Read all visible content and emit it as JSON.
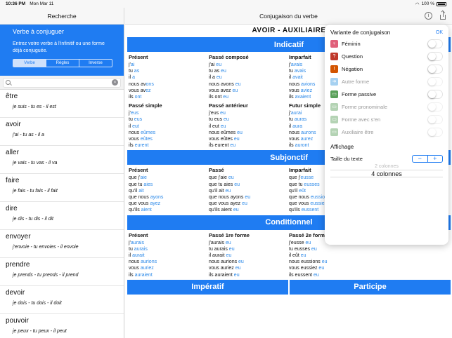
{
  "status": {
    "time": "10:36 PM",
    "date": "Mon Mar 11",
    "battery": "100 %"
  },
  "left": {
    "header": "Recherche",
    "box_title": "Verbe à conjuguer",
    "box_desc": "Entrez votre verbe à l'infinitif ou une forme déjà conjuguée.",
    "segments": [
      "Verbe",
      "Règles",
      "Inverse"
    ],
    "search_placeholder": "",
    "verbs": [
      {
        "verb": "être",
        "forms": "je suis - tu es - il est"
      },
      {
        "verb": "avoir",
        "forms": "j'ai - tu as - il a"
      },
      {
        "verb": "aller",
        "forms": "je vais - tu vas - il va"
      },
      {
        "verb": "faire",
        "forms": "je fais - tu fais - il fait"
      },
      {
        "verb": "dire",
        "forms": "je dis - tu dis - il dit"
      },
      {
        "verb": "envoyer",
        "forms": "j'envoie - tu envoies - il envoie"
      },
      {
        "verb": "prendre",
        "forms": "je prends - tu prends - il prend"
      },
      {
        "verb": "devoir",
        "forms": "je dois - tu dois - il doit"
      },
      {
        "verb": "pouvoir",
        "forms": "je peux - tu peux - il peut"
      }
    ]
  },
  "main": {
    "nav_title": "Conjugaison du verbe",
    "info_glyph": "i",
    "verb_title": "AVOIR - AUXILIAIRE",
    "sections": {
      "indicatif": "Indicatif",
      "subjonctif": "Subjonctif",
      "conditionnel": "Conditionnel",
      "imperatif": "Impératif",
      "participe": "Participe"
    },
    "indicatif_row1": [
      {
        "name": "Présent",
        "lines": [
          [
            "j'",
            "ai"
          ],
          [
            "tu ",
            "as"
          ],
          [
            "il ",
            "a"
          ],
          [
            "nous av",
            "ons"
          ],
          [
            "vous av",
            "ez"
          ],
          [
            "ils ",
            "ont"
          ]
        ]
      },
      {
        "name": "Passé composé",
        "lines": [
          [
            "j'ai ",
            "eu"
          ],
          [
            "tu as ",
            "eu"
          ],
          [
            "il a ",
            "eu"
          ],
          [
            "nous avons ",
            "eu"
          ],
          [
            "vous avez ",
            "eu"
          ],
          [
            "ils ont ",
            "eu"
          ]
        ]
      },
      {
        "name": "Imparfait",
        "lines": [
          [
            "j'",
            "avais"
          ],
          [
            "tu ",
            "avais"
          ],
          [
            "il ",
            "avait"
          ],
          [
            "nous ",
            "avions"
          ],
          [
            "vous ",
            "aviez"
          ],
          [
            "ils ",
            "avaient"
          ]
        ]
      }
    ],
    "indicatif_row2": [
      {
        "name": "Passé simple",
        "lines": [
          [
            "j'",
            "eus"
          ],
          [
            "tu ",
            "eus"
          ],
          [
            "il ",
            "eut"
          ],
          [
            "nous ",
            "eûmes"
          ],
          [
            "vous ",
            "eûtes"
          ],
          [
            "ils ",
            "eurent"
          ]
        ]
      },
      {
        "name": "Passé antérieur",
        "lines": [
          [
            "j'eus ",
            "eu"
          ],
          [
            "tu eus ",
            "eu"
          ],
          [
            "il eut ",
            "eu"
          ],
          [
            "nous eûmes ",
            "eu"
          ],
          [
            "vous eûtes ",
            "eu"
          ],
          [
            "ils eurent ",
            "eu"
          ]
        ]
      },
      {
        "name": "Futur simple",
        "lines": [
          [
            "j'",
            "aurai"
          ],
          [
            "tu ",
            "auras"
          ],
          [
            "il ",
            "aura"
          ],
          [
            "nous ",
            "aurons"
          ],
          [
            "vous ",
            "aurez"
          ],
          [
            "ils ",
            "auront"
          ]
        ]
      }
    ],
    "subjonctif": [
      {
        "name": "Présent",
        "lines": [
          [
            "que j'",
            "aie"
          ],
          [
            "que tu ",
            "aies"
          ],
          [
            "qu'il ",
            "ait"
          ],
          [
            "que nous ",
            "ayons"
          ],
          [
            "que vous ",
            "ayez"
          ],
          [
            "qu'ils ",
            "aient"
          ]
        ]
      },
      {
        "name": "Passé",
        "lines": [
          [
            "que j'aie ",
            "eu"
          ],
          [
            "que tu aies ",
            "eu"
          ],
          [
            "qu'il ait ",
            "eu"
          ],
          [
            "que nous ayons ",
            "eu"
          ],
          [
            "que vous ayez ",
            "eu"
          ],
          [
            "qu'ils aient ",
            "eu"
          ]
        ]
      },
      {
        "name": "Imparfait",
        "lines": [
          [
            "que j'",
            "eusse"
          ],
          [
            "que tu ",
            "eusses"
          ],
          [
            "qu'il ",
            "eût"
          ],
          [
            "que nous ",
            "eussions"
          ],
          [
            "que vous ",
            "eussiez"
          ],
          [
            "qu'ils ",
            "eussent"
          ]
        ]
      }
    ],
    "conditionnel": [
      {
        "name": "Présent",
        "lines": [
          [
            "j'",
            "aurais"
          ],
          [
            "tu ",
            "aurais"
          ],
          [
            "il ",
            "aurait"
          ],
          [
            "nous ",
            "aurions"
          ],
          [
            "vous ",
            "auriez"
          ],
          [
            "ils ",
            "auraient"
          ]
        ]
      },
      {
        "name": "Passé 1re forme",
        "lines": [
          [
            "j'aurais ",
            "eu"
          ],
          [
            "tu aurais ",
            "eu"
          ],
          [
            "il aurait ",
            "eu"
          ],
          [
            "nous aurions ",
            "eu"
          ],
          [
            "vous auriez ",
            "eu"
          ],
          [
            "ils auraient ",
            "eu"
          ]
        ]
      },
      {
        "name": "Passé 2e forme",
        "lines": [
          [
            "j'eusse ",
            "eu"
          ],
          [
            "tu eusses ",
            "eu"
          ],
          [
            "il eût ",
            "eu"
          ],
          [
            "nous eussions ",
            "eu"
          ],
          [
            "vous eussiez ",
            "eu"
          ],
          [
            "ils eussent ",
            "eu"
          ]
        ]
      }
    ]
  },
  "popover": {
    "title": "Variante de conjugaison",
    "ok": "OK",
    "options": [
      {
        "label": "Féminin",
        "icon": "female-icon",
        "color": "#e0607a",
        "glyph": "♀",
        "enabled": true
      },
      {
        "label": "Question",
        "icon": "question-icon",
        "color": "#c0392b",
        "glyph": "?",
        "enabled": true
      },
      {
        "label": "Négation",
        "icon": "negation-icon",
        "color": "#d35400",
        "glyph": "!",
        "enabled": true
      },
      {
        "label": "Autre forme",
        "icon": "arrow-icon",
        "color": "#3b9ae1",
        "glyph": "➜",
        "enabled": false
      },
      {
        "label": "Forme passive",
        "icon": "passive-icon",
        "color": "#5aa05a",
        "glyph": "▭",
        "enabled": true
      },
      {
        "label": "Forme pronominale",
        "icon": "pronominal-icon",
        "color": "#5aa05a",
        "glyph": "▭",
        "enabled": false
      },
      {
        "label": "Forme avec s'en",
        "icon": "sen-icon",
        "color": "#5aa05a",
        "glyph": "▭",
        "enabled": false
      },
      {
        "label": "Auxiliaire être",
        "icon": "auxiliary-icon",
        "color": "#5aa05a",
        "glyph": "▭",
        "enabled": false
      }
    ],
    "display_title": "Affichage",
    "text_size_label": "Taille du texte",
    "stepper_minus": "−",
    "stepper_plus": "+",
    "picker_prev": "2 colonnes",
    "picker_selected": "4 colonnes"
  }
}
